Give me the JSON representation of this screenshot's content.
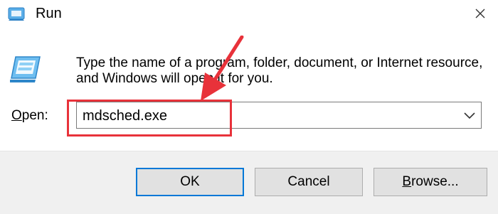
{
  "window": {
    "title": "Run",
    "app_icon": "run-icon",
    "close_icon": "close-icon"
  },
  "content": {
    "icon": "run-dialog-icon",
    "description": "Type the name of a program, folder, document, or Internet resource, and Windows will open it for you.",
    "open_label_prefix": "O",
    "open_label_rest": "pen:",
    "open_value": "mdsched.exe",
    "dropdown_icon": "chevron-down-icon"
  },
  "buttons": {
    "ok": "OK",
    "cancel": "Cancel",
    "browse_prefix": "B",
    "browse_rest": "rowse..."
  },
  "annotation": {
    "color": "#e8323a",
    "arrow_icon": "red-arrow-icon"
  },
  "colors": {
    "accent": "#0078d7",
    "footer_bg": "#f0f0f0",
    "button_bg": "#e1e1e1"
  }
}
